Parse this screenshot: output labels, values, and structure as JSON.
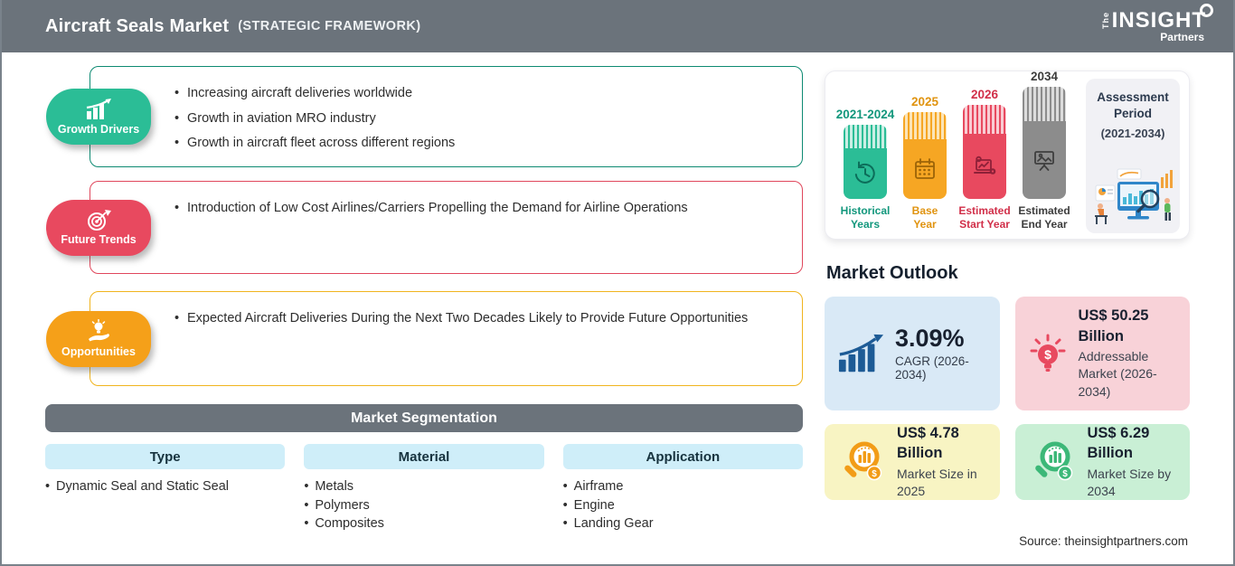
{
  "header": {
    "title": "Aircraft Seals Market",
    "subtitle": "(STRATEGIC FRAMEWORK)",
    "logo": {
      "the": "The",
      "insight": "INSIGHT",
      "partners": "Partners"
    }
  },
  "sections": {
    "growth_drivers": {
      "label": "Growth Drivers",
      "bullets": [
        "Increasing aircraft deliveries worldwide",
        "Growth in aviation MRO industry",
        "Growth in aircraft fleet across different regions"
      ]
    },
    "future_trends": {
      "label": "Future Trends",
      "bullets": [
        "Introduction of Low Cost Airlines/Carriers Propelling the Demand for Airline Operations"
      ]
    },
    "opportunities": {
      "label": "Opportunities",
      "bullets": [
        "Expected Aircraft Deliveries During the Next Two Decades Likely to Provide Future Opportunities"
      ]
    }
  },
  "segmentation": {
    "title": "Market Segmentation",
    "columns": [
      {
        "header": "Type",
        "items": [
          "Dynamic Seal and Static Seal"
        ]
      },
      {
        "header": "Material",
        "items": [
          "Metals",
          "Polymers",
          "Composites"
        ]
      },
      {
        "header": "Application",
        "items": [
          "Airframe",
          "Engine",
          "Landing Gear"
        ]
      }
    ]
  },
  "timeline": {
    "bars": [
      {
        "year": "2021-2024",
        "label": "Historical Years",
        "color": "#2bbd96"
      },
      {
        "year": "2025",
        "label": "Base Year",
        "color": "#f6a623"
      },
      {
        "year": "2026",
        "label": "Estimated Start Year",
        "color": "#e8495f"
      },
      {
        "year": "2034",
        "label": "Estimated End Year",
        "color": "#8c8c8c"
      }
    ],
    "assessment": {
      "title": "Assessment Period",
      "range": "(2021-2034)"
    }
  },
  "outlook": {
    "title": "Market Outlook",
    "cards": [
      {
        "value": "3.09%",
        "label": "CAGR (2026-2034)",
        "bg": "#d9e9f6"
      },
      {
        "value": "US$ 50.25 Billion",
        "label": "Addressable Market (2026-2034)",
        "bg": "#f8d2d8"
      },
      {
        "value": "US$ 4.78 Billion",
        "label": "Market Size in 2025",
        "bg": "#f8f4c3"
      },
      {
        "value": "US$ 6.29 Billion",
        "label": "Market Size by 2034",
        "bg": "#c9efd5"
      }
    ]
  },
  "source": "Source: theinsightpartners.com",
  "colors": {
    "header_gray": "#6b737b",
    "growth_pill": "#2bbd96",
    "growth_border": "#0d8a72",
    "trends_pill": "#e8495f",
    "trends_border": "#e0475c",
    "opportunities_pill": "#f5a019",
    "opportunities_border": "#f0b41e",
    "segment_header_blue": "#cfeef9",
    "cagr_icon_navy": "#1d5b96",
    "size2025_icon_orange": "#f29c17",
    "size2034_icon_green": "#3cb878"
  },
  "icons": {
    "growth_drivers": "rising-bar-chart-arrow",
    "future_trends": "target-with-dart",
    "opportunities": "hand-holding-lightbulb",
    "historical_years": "history-clock",
    "base_year": "calendar",
    "estimated_start_year": "laptop-analytics-gear",
    "estimated_end_year": "presentation-screen",
    "cagr": "bar-chart-growth-arrow",
    "addressable_market": "lightbulb-dollar",
    "market_size": "magnifier-bar-chart-coin",
    "logo": "magnifying-glass"
  }
}
